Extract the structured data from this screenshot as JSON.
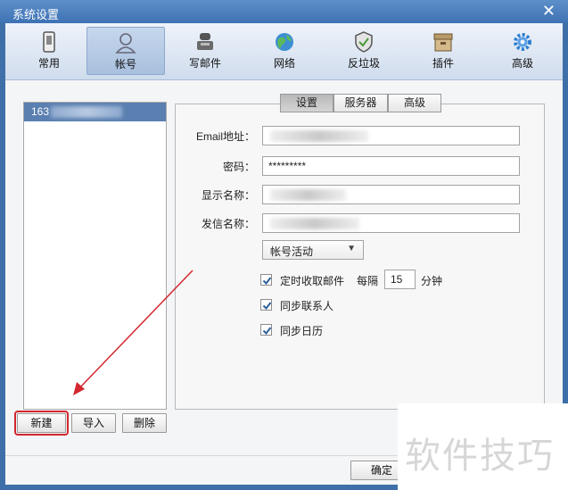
{
  "window": {
    "title": "系统设置"
  },
  "toolbar": {
    "items": [
      {
        "label": "常用",
        "icon": "phone-icon"
      },
      {
        "label": "帐号",
        "icon": "user-icon",
        "active": true
      },
      {
        "label": "写邮件",
        "icon": "compose-icon"
      },
      {
        "label": "网络",
        "icon": "globe-icon"
      },
      {
        "label": "反垃圾",
        "icon": "shield-icon"
      },
      {
        "label": "插件",
        "icon": "plugin-box-icon"
      },
      {
        "label": "高级",
        "icon": "gear-icon"
      }
    ]
  },
  "accounts": {
    "items": [
      {
        "label": "163"
      }
    ],
    "buttons": {
      "new": "新建",
      "import": "导入",
      "delete": "删除"
    }
  },
  "tabs": [
    {
      "label": "设置",
      "active": true
    },
    {
      "label": "服务器"
    },
    {
      "label": "高级"
    }
  ],
  "form": {
    "email_label": "Email地址：",
    "password_label": "密码：",
    "password_value": "*********",
    "display_label": "显示名称：",
    "sender_label": "发信名称：",
    "status_value": "帐号活动",
    "auto_receive_label": "定时收取邮件",
    "every_label": "每隔",
    "interval_value": "15",
    "minute_label": "分钟",
    "sync_contacts_label": "同步联系人",
    "sync_calendar_label": "同步日历"
  },
  "footer": {
    "ok_label": "确定"
  },
  "watermark": {
    "text": "软件技巧"
  },
  "colors": {
    "accent": "#3e72b4",
    "selected_item": "#5a7fb1",
    "highlight": "#d3272f",
    "arrow": "#d3272f"
  }
}
